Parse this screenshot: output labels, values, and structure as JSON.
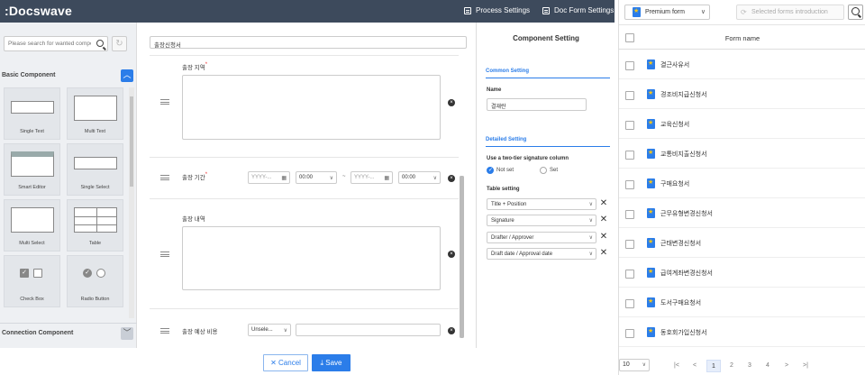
{
  "app": {
    "logo": ":Docswave"
  },
  "topbar": {
    "process_settings": "Process Settings",
    "doc_form_settings": "Doc Form Settings"
  },
  "palette": {
    "search_placeholder": "Please search for wanted component",
    "basic_section": "Basic Component",
    "connection_section": "Connection Component",
    "tiles": [
      "Single Text",
      "Multi Text",
      "Smart Editor",
      "Single Select",
      "Multi Select",
      "Table",
      "Check Box",
      "Radio Button"
    ]
  },
  "form": {
    "title": "출장신청서",
    "fields": [
      {
        "label": "출장 지역",
        "required": true
      },
      {
        "label": "출장 기간",
        "required": true,
        "date_placeholder": "YYYY-...",
        "time_value": "00:00",
        "range_sep": "~"
      },
      {
        "label": "출장 내역",
        "required": false
      },
      {
        "label": "출장 예상 비용",
        "required": false,
        "select_placeholder": "Unsele..."
      }
    ],
    "required_mark": "*",
    "delete_icon": "×"
  },
  "settings": {
    "title": "Component Setting",
    "common_section": "Common Setting",
    "name_label": "Name",
    "name_value": "결재란",
    "detailed_section": "Detailed Setting",
    "two_tier_label": "Use a two-tier signature column",
    "radio_options": [
      "Not set",
      "Set"
    ],
    "radio_selected": "Not set",
    "table_label": "Table setting",
    "table_rows": [
      "Title + Position",
      "Signature",
      "Drafter / Approver",
      "Draft date / Approval date"
    ]
  },
  "actions": {
    "cancel": "Cancel",
    "save": "Save"
  },
  "popup": {
    "form_select": "Premium form",
    "intro_button": "Selected forms introduction",
    "column_header": "Form name",
    "forms": [
      "결근사유서",
      "경조비지급신청서",
      "교육신청서",
      "교통비지출신청서",
      "구매요청서",
      "근무유형변경신청서",
      "근태변경신청서",
      "급여계좌변경신청서",
      "도서구매요청서",
      "동호회가입신청서"
    ],
    "page_size": "10",
    "pages": [
      "1",
      "2",
      "3",
      "4"
    ],
    "current_page": "1",
    "nav_first": "|<",
    "nav_prev": "<",
    "nav_next": ">",
    "nav_last": ">|"
  }
}
